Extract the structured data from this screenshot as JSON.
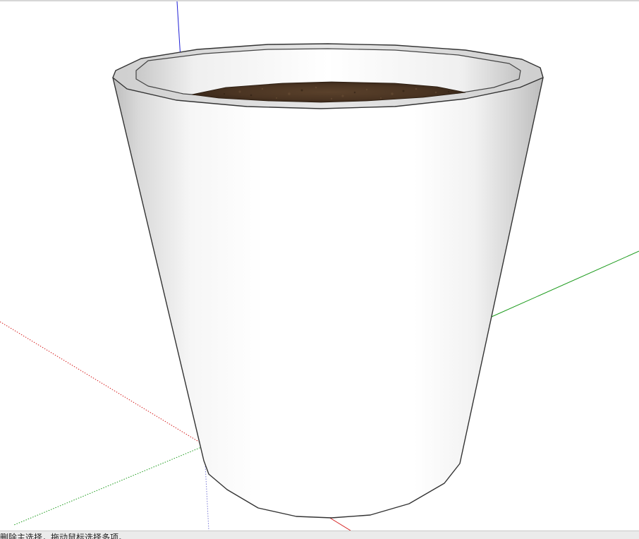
{
  "status_bar": {
    "hint": "删除主选择，拖动鼠标选择多项。"
  },
  "colors": {
    "background": "#ffffff",
    "axis_blue": "#1f1fd6",
    "axis_green": "#1a9a1a",
    "axis_red": "#d62020",
    "pot_body": "#f4f4f4",
    "pot_edge": "#333333",
    "soil": "#4a3422",
    "status_bg": "#ebebeb"
  },
  "model": {
    "object": "flower-pot",
    "contents": "soil"
  }
}
